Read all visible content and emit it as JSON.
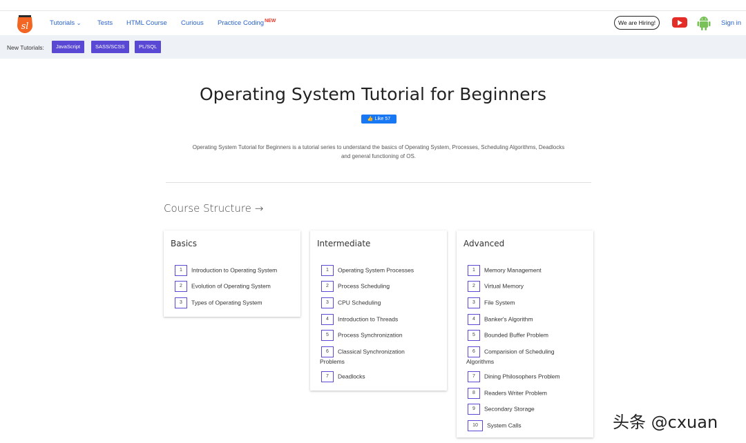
{
  "nav": {
    "links": [
      "Tutorials",
      "Tests",
      "HTML Course",
      "Curious",
      "Practice Coding"
    ],
    "new_badge": "NEW",
    "hiring": "We are Hiring!",
    "signin": "Sign in"
  },
  "subbar": {
    "label": "New Tutorials:",
    "chips": [
      "JavaScript",
      "SASS/SCSS",
      "PL/SQL"
    ]
  },
  "main": {
    "title": "Operating System Tutorial for Beginners",
    "like": "Like 57",
    "description_line1": "Operating System Tutorial for Beginners is a tutorial series to understand the basics of Operating System, Processes, Scheduling Algorithms, Deadlocks",
    "description_line2": "and general functioning of OS.",
    "course_heading": "Course Structure →"
  },
  "cards": {
    "basics": {
      "title": "Basics",
      "items": [
        "Introduction to Operating System",
        "Evolution of Operating System",
        "Types of Operating System"
      ]
    },
    "intermediate": {
      "title": "Intermediate",
      "items": [
        "Operating System Processes",
        "Process Scheduling",
        "CPU Scheduling",
        "Introduction to Threads",
        "Process Synchronization",
        "Classical Synchronization",
        "Problems",
        "Deadlocks"
      ]
    },
    "advanced": {
      "title": "Advanced",
      "items": [
        "Memory Management",
        "Virtual Memory",
        "File System",
        "Banker's Algorithm",
        "Bounded Buffer Problem",
        "Comparision of Scheduling",
        "Algorithms",
        "Dining Philosophers Problem",
        "Readers Writer Problem",
        "Secondary Storage",
        "System Calls"
      ]
    }
  },
  "numbers": [
    "1",
    "2",
    "3",
    "4",
    "5",
    "6",
    "7",
    "8",
    "9",
    "10"
  ],
  "watermark": "头条 @cxuan",
  "colors": {
    "link": "#2a63c9",
    "chip": "#5848d4",
    "youtube": "#e52d27",
    "android": "#78c257",
    "like": "#1877f2"
  },
  "icons": [
    "logo-icon",
    "chevron-down-icon",
    "youtube-icon",
    "android-icon",
    "thumbs-up-icon"
  ]
}
